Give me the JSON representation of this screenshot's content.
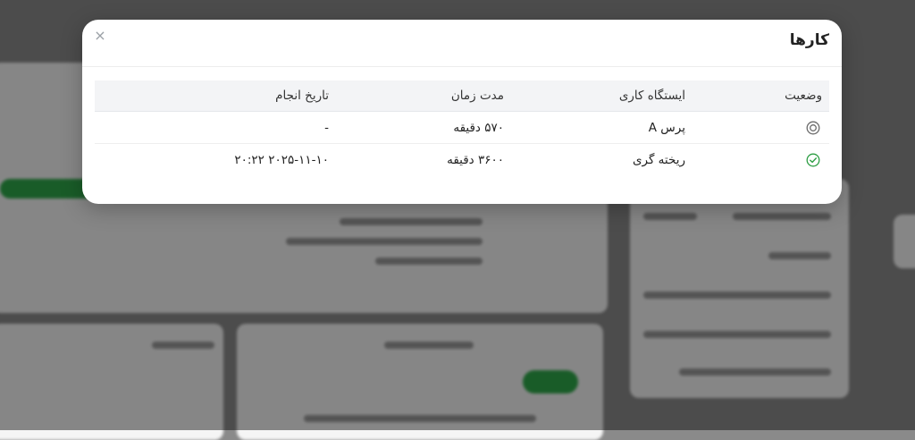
{
  "modal": {
    "title": "کارها",
    "close_icon": "×"
  },
  "table": {
    "headers": {
      "status": "وضعیت",
      "station": "ایستگاه کاری",
      "duration": "مدت زمان",
      "date": "تاریخ انجام"
    },
    "rows": [
      {
        "status_icon": "pending-circle-icon",
        "station": "پرس A",
        "duration": "۵۷۰ دقیقه",
        "date": "-"
      },
      {
        "status_icon": "check-circle-icon",
        "station": "ریخته گری",
        "duration": "۳۶۰۰ دقیقه",
        "date": "۲۰۲۵-۱۱-۱۰ ۲۰:۲۲"
      }
    ]
  },
  "colors": {
    "success": "#2e9e44",
    "pending": "#6b6b6b",
    "overlay": "rgba(0,0,0,0.45)"
  }
}
